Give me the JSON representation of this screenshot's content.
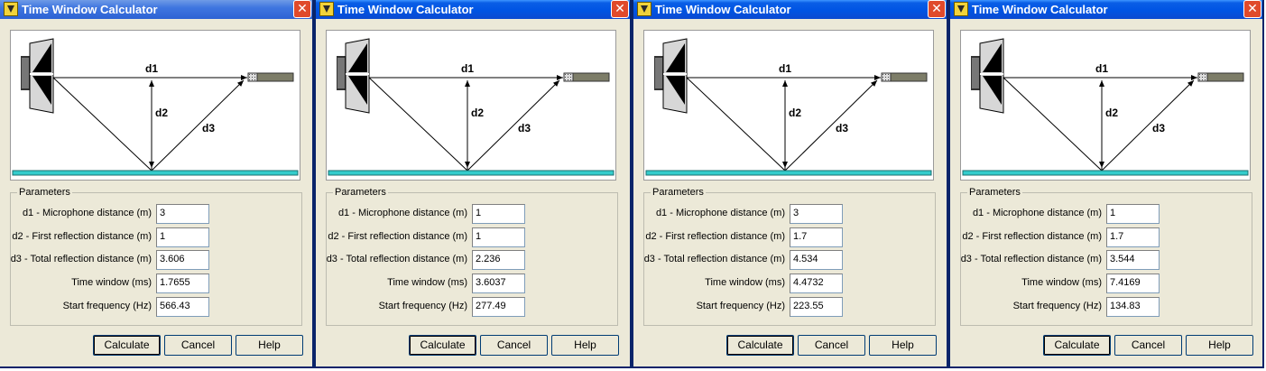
{
  "windows": [
    {
      "title": "Time Window Calculator",
      "diagram": {
        "d1": "d1",
        "d2": "d2",
        "d3": "d3"
      },
      "params": {
        "legend": "Parameters",
        "rows": [
          {
            "label": "d1 - Microphone distance (m)",
            "value": "3"
          },
          {
            "label": "d2 - First reflection distance (m)",
            "value": "1"
          },
          {
            "label": "d3 - Total reflection distance (m)",
            "value": "3.606"
          },
          {
            "label": "Time window (ms)",
            "value": "1.7655"
          },
          {
            "label": "Start frequency (Hz)",
            "value": "566.43"
          }
        ]
      },
      "buttons": {
        "calculate": "Calculate",
        "cancel": "Cancel",
        "help": "Help"
      }
    },
    {
      "title": "Time Window Calculator",
      "diagram": {
        "d1": "d1",
        "d2": "d2",
        "d3": "d3"
      },
      "params": {
        "legend": "Parameters",
        "rows": [
          {
            "label": "d1 - Microphone distance (m)",
            "value": "1"
          },
          {
            "label": "d2 - First reflection distance (m)",
            "value": "1"
          },
          {
            "label": "d3 - Total reflection distance (m)",
            "value": "2.236"
          },
          {
            "label": "Time window (ms)",
            "value": "3.6037"
          },
          {
            "label": "Start frequency (Hz)",
            "value": "277.49"
          }
        ]
      },
      "buttons": {
        "calculate": "Calculate",
        "cancel": "Cancel",
        "help": "Help"
      }
    },
    {
      "title": "Time Window Calculator",
      "diagram": {
        "d1": "d1",
        "d2": "d2",
        "d3": "d3"
      },
      "params": {
        "legend": "Parameters",
        "rows": [
          {
            "label": "d1 - Microphone distance (m)",
            "value": "3"
          },
          {
            "label": "d2 - First reflection distance (m)",
            "value": "1.7"
          },
          {
            "label": "d3 - Total reflection distance (m)",
            "value": "4.534"
          },
          {
            "label": "Time window (ms)",
            "value": "4.4732"
          },
          {
            "label": "Start frequency (Hz)",
            "value": "223.55"
          }
        ]
      },
      "buttons": {
        "calculate": "Calculate",
        "cancel": "Cancel",
        "help": "Help"
      }
    },
    {
      "title": "Time Window Calculator",
      "diagram": {
        "d1": "d1",
        "d2": "d2",
        "d3": "d3"
      },
      "params": {
        "legend": "Parameters",
        "rows": [
          {
            "label": "d1 - Microphone distance (m)",
            "value": "1"
          },
          {
            "label": "d2 - First reflection distance (m)",
            "value": "1.7"
          },
          {
            "label": "d3 - Total reflection distance (m)",
            "value": "3.544"
          },
          {
            "label": "Time window (ms)",
            "value": "7.4169"
          },
          {
            "label": "Start frequency (Hz)",
            "value": "134.83"
          }
        ]
      },
      "buttons": {
        "calculate": "Calculate",
        "cancel": "Cancel",
        "help": "Help"
      }
    }
  ],
  "icons": {
    "app": "app-icon",
    "close": "close-icon",
    "close_glyph": "✕"
  },
  "colors": {
    "titlebar": "#0054e3",
    "close": "#e04a2b",
    "floor": "#33cccc",
    "window_bg": "#ece9d8"
  }
}
